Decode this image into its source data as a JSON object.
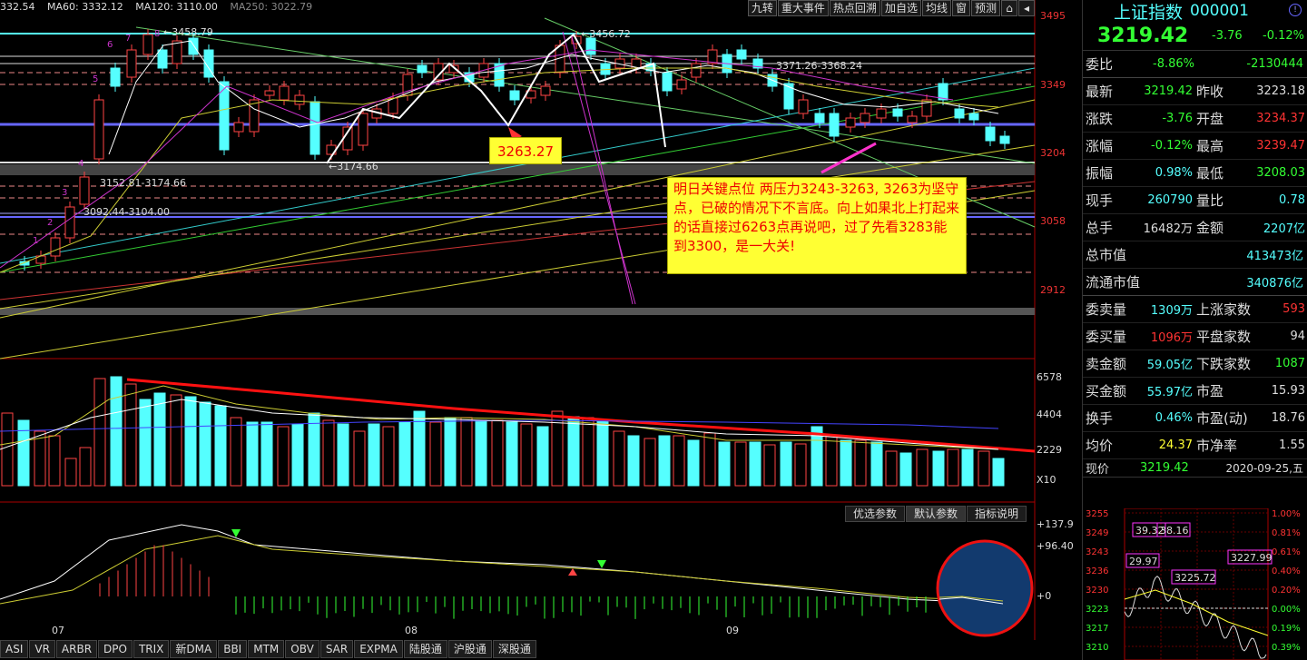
{
  "ma_legend": [
    {
      "text": "332.54",
      "color": "#dddddd"
    },
    {
      "text": "MA60: 3332.12",
      "color": "#dddddd"
    },
    {
      "text": "MA120: 3110.00",
      "color": "#dddddd"
    },
    {
      "text": "MA250: 3022.79",
      "color": "#888888"
    }
  ],
  "toolbar": [
    "九转",
    "重大事件",
    "热点回溯",
    "加自选",
    "均线",
    "窗",
    "预测"
  ],
  "price_axis": [
    "3495",
    "3349",
    "3204",
    "3058",
    "2912"
  ],
  "volume_axis": [
    "6578",
    "4404",
    "2229",
    "X10"
  ],
  "macd_axis": [
    "+137.9",
    "+96.40",
    "+0"
  ],
  "months": [
    "07",
    "08",
    "09"
  ],
  "chart_text": {
    "high1": "3458.79",
    "high2": "3456.72",
    "range1": "3371.26-3368.24",
    "range2": "3152.81-3174.66",
    "range3": "3092.44-3104.00",
    "low1": "3174.66",
    "tag": "3263.27",
    "wave": [
      "1",
      "2",
      "3",
      "4",
      "5",
      "6",
      "7",
      "8"
    ],
    "note": "明日关键点位 两压力3243-3263, 3263为坚守点，已破的情况下不言底。向上如果北上打起来的话直接过6263点再说吧，过了先看3283能到3300，是一大关!"
  },
  "param_tabs": [
    "优选参数",
    "默认参数",
    "指标说明"
  ],
  "bottom_tabs": [
    "ASI",
    "VR",
    "ARBR",
    "DPO",
    "TRIX",
    "新DMA",
    "BBI",
    "MTM",
    "OBV",
    "SAR",
    "EXPMA",
    "陆股通",
    "沪股通",
    "深股通"
  ],
  "side": {
    "name": "上证指数",
    "code": "000001",
    "price": "3219.42",
    "change": "-3.76",
    "pct": "-0.12%",
    "weibi": {
      "label": "委比",
      "pct": "-8.86%",
      "val": "-2130444"
    },
    "rows": [
      {
        "l1": "最新",
        "v1": "3219.42",
        "c1": "g",
        "l2": "昨收",
        "v2": "3223.18",
        "c2": "w"
      },
      {
        "l1": "涨跌",
        "v1": "-3.76",
        "c1": "g",
        "l2": "开盘",
        "v2": "3234.37",
        "c2": "r"
      },
      {
        "l1": "涨幅",
        "v1": "-0.12%",
        "c1": "g",
        "l2": "最高",
        "v2": "3239.47",
        "c2": "r"
      },
      {
        "l1": "振幅",
        "v1": "0.98%",
        "c1": "c",
        "l2": "最低",
        "v2": "3208.03",
        "c2": "g"
      },
      {
        "l1": "现手",
        "v1": "260790",
        "c1": "c",
        "l2": "量比",
        "v2": "0.78",
        "c2": "c"
      },
      {
        "l1": "总手",
        "v1": "16482万",
        "c1": "w",
        "l2": "金额",
        "v2": "2207亿",
        "c2": "c"
      }
    ],
    "cap": [
      {
        "label": "总市值",
        "val": "413473亿"
      },
      {
        "label": "流通市值",
        "val": "340876亿"
      }
    ],
    "rows2": [
      {
        "l1": "委卖量",
        "v1": "1309万",
        "c1": "c",
        "l2": "上涨家数",
        "v2": "593",
        "c2": "r"
      },
      {
        "l1": "委买量",
        "v1": "1096万",
        "c1": "r",
        "l2": "平盘家数",
        "v2": "94",
        "c2": "w"
      },
      {
        "l1": "卖金额",
        "v1": "59.05亿",
        "c1": "c",
        "l2": "下跌家数",
        "v2": "1087",
        "c2": "g"
      },
      {
        "l1": "买金额",
        "v1": "55.97亿",
        "c1": "c",
        "l2": "市盈",
        "v2": "15.93",
        "c2": "w"
      },
      {
        "l1": "换手",
        "v1": "0.46%",
        "c1": "c",
        "l2": "市盈(动)",
        "v2": "18.76",
        "c2": "w"
      },
      {
        "l1": "均价",
        "v1": "24.37",
        "c1": "y",
        "l2": "市净率",
        "v2": "1.55",
        "c2": "w"
      }
    ],
    "current": {
      "label": "现价",
      "val": "3219.42",
      "date": "2020-09-25,五"
    },
    "mini_left": [
      "3255",
      "3249",
      "3243",
      "3236",
      "3230",
      "3223",
      "3217",
      "3210"
    ],
    "mini_right": [
      "1.00%",
      "0.81%",
      "0.61%",
      "0.40%",
      "0.20%",
      "0.00%",
      "0.19%",
      "0.39%"
    ],
    "mini_tags": [
      "39.32",
      "38.16",
      "29.97",
      "3225.72",
      "3227.99"
    ]
  }
}
